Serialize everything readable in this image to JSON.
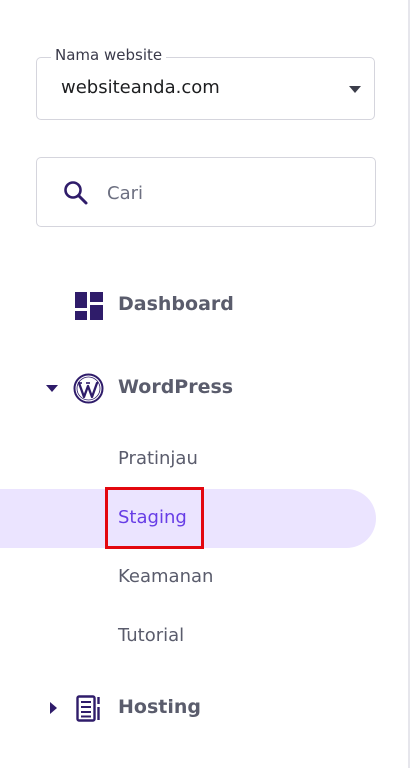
{
  "website_select": {
    "label": "Nama website",
    "value": "websiteanda.com"
  },
  "search": {
    "placeholder": "Cari"
  },
  "nav": {
    "dashboard": {
      "label": "Dashboard",
      "icon": "dashboard-icon"
    },
    "wordpress": {
      "label": "WordPress",
      "icon": "wordpress-icon",
      "expanded": true,
      "items": [
        {
          "label": "Pratinjau"
        },
        {
          "label": "Staging",
          "active": true
        },
        {
          "label": "Keamanan"
        },
        {
          "label": "Tutorial"
        }
      ]
    },
    "hosting": {
      "label": "Hosting",
      "icon": "server-icon",
      "expanded": false
    }
  },
  "colors": {
    "active_bg": "#ebe4ff",
    "active_text": "#673de6",
    "highlight": "#e3070f",
    "icon": "#2f1c6a",
    "text": "#5a5c6c"
  }
}
